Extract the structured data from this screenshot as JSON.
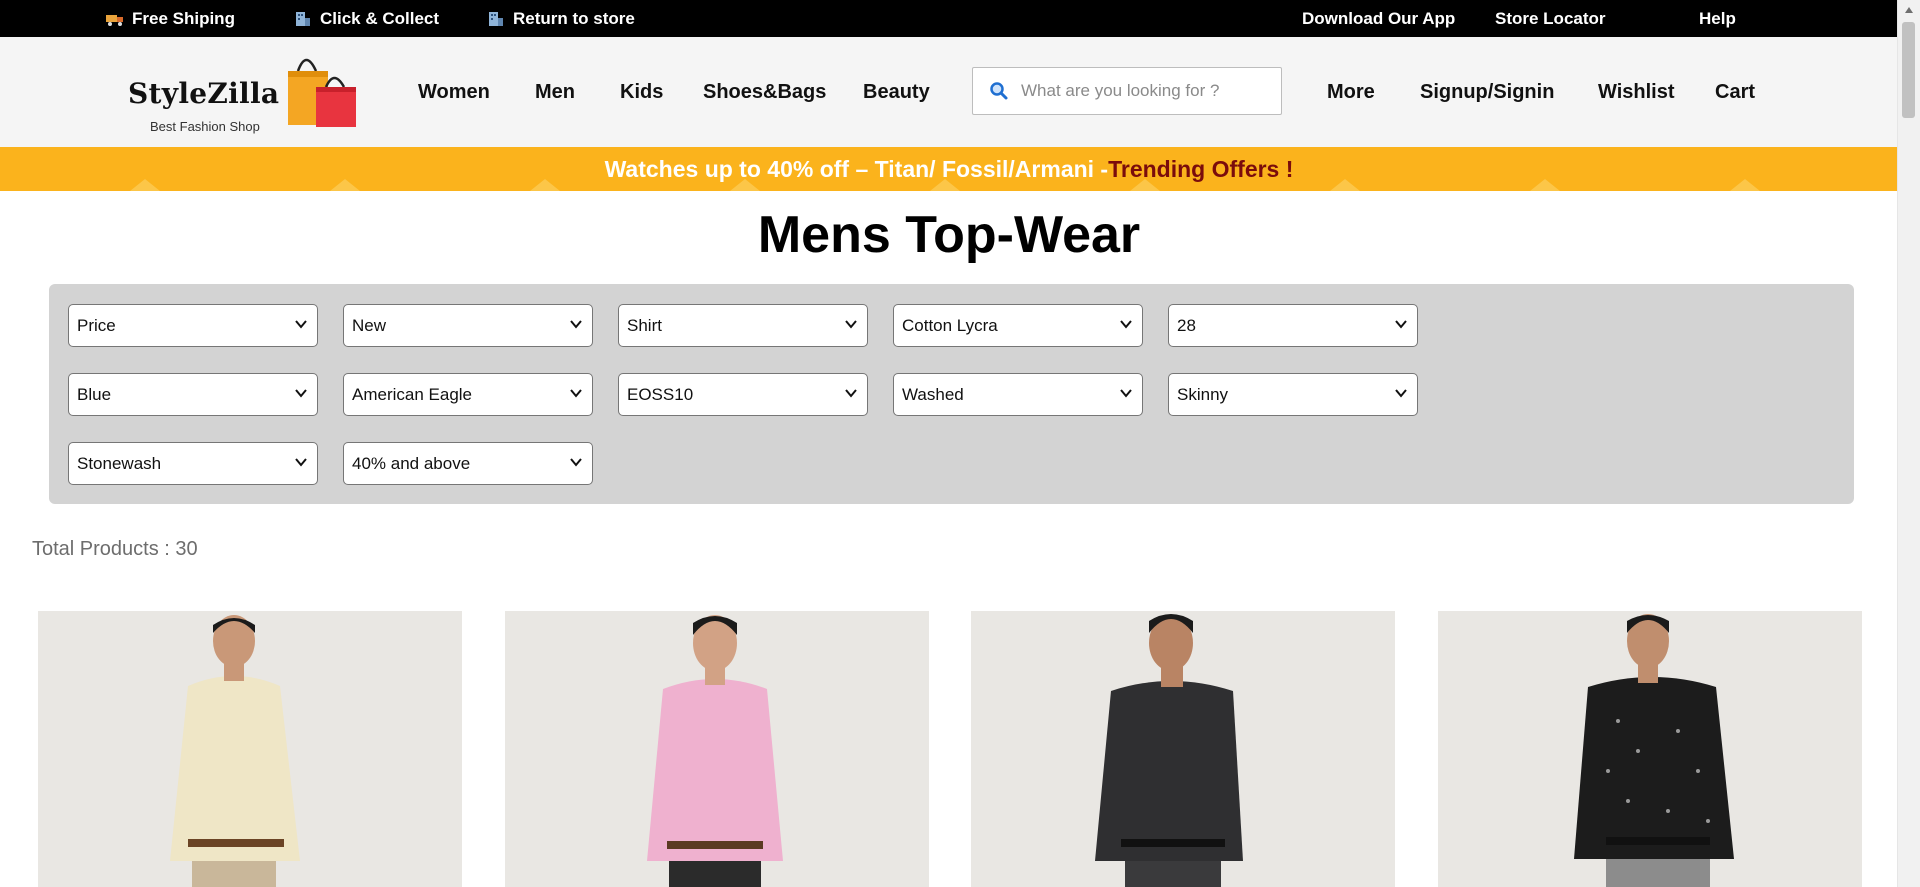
{
  "topbar": {
    "free_shipping": "Free Shiping",
    "click_collect": "Click & Collect",
    "return_store": "Return to store",
    "download_app": "Download Our App",
    "store_locator": "Store Locator",
    "help": "Help"
  },
  "logo": {
    "name": "StyleZilla",
    "tagline": "Best Fashion Shop"
  },
  "nav": {
    "women": "Women",
    "men": "Men",
    "kids": "Kids",
    "shoes_bags": "Shoes&Bags",
    "beauty": "Beauty",
    "more": "More",
    "signup": "Signup/Signin",
    "wishlist": "Wishlist",
    "cart": "Cart"
  },
  "search": {
    "placeholder": "What are you looking for ?",
    "icon": "search-icon"
  },
  "promo": {
    "text": "Watches up to 40% off – Titan/ Fossil/Armani -",
    "offer": "Trending Offers !"
  },
  "page": {
    "title": "Mens Top-Wear",
    "total_products": "Total Products : 30"
  },
  "filters": {
    "price": "Price",
    "arrival": "New",
    "type": "Shirt",
    "fabric": "Cotton Lycra",
    "size": "28",
    "color": "Blue",
    "brand": "American Eagle",
    "sale": "EOSS10",
    "finish": "Washed",
    "fit": "Skinny",
    "wash": "Stonewash",
    "discount": "40% and above"
  },
  "products": [
    {
      "shirt_color": "#efe6c6",
      "pant_color": "#c9b79a"
    },
    {
      "shirt_color": "#efb1cf",
      "pant_color": "#2b2b2b"
    },
    {
      "shirt_color": "#2f2f31",
      "pant_color": "#3a3a3c"
    },
    {
      "shirt_color": "#1c1c1c",
      "pant_color": "#8c8c8c"
    }
  ],
  "colors": {
    "topbar": "#000000",
    "promo": "#fbb31c",
    "promo_offer": "#7a0c0c",
    "filter_panel": "#d3d3d3"
  }
}
